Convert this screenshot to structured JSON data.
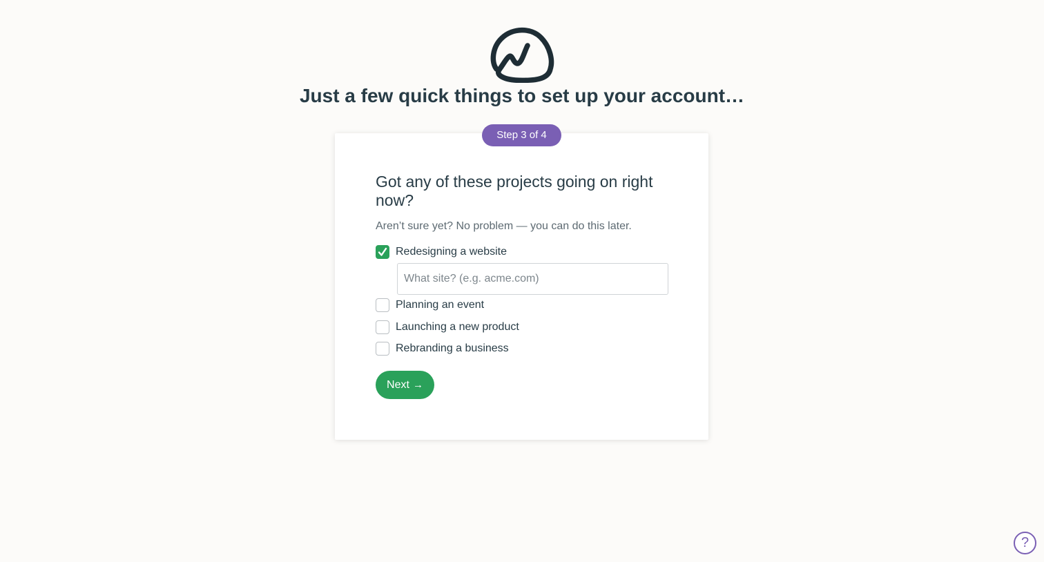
{
  "headline": "Just a few quick things to set up your account…",
  "step": {
    "label": "Step 3 of 4"
  },
  "form": {
    "question": "Got any of these projects going on right now?",
    "subtext": "Aren’t sure yet? No problem — you can do this later.",
    "options": [
      {
        "label": "Redesigning a website",
        "checked": true
      },
      {
        "label": "Planning an event",
        "checked": false
      },
      {
        "label": "Launching a new product",
        "checked": false
      },
      {
        "label": "Rebranding a business",
        "checked": false
      }
    ],
    "site_input": {
      "placeholder": "What site? (e.g. acme.com)",
      "value": ""
    },
    "next_label": "Next",
    "next_icon": "arrow-right-icon"
  },
  "help": {
    "icon": "question-mark-icon",
    "glyph": "?"
  },
  "colors": {
    "accent_purple": "#7a5fb4",
    "accent_green": "#2aa15a",
    "text_dark": "#283c46",
    "background": "#fcfbf9"
  }
}
